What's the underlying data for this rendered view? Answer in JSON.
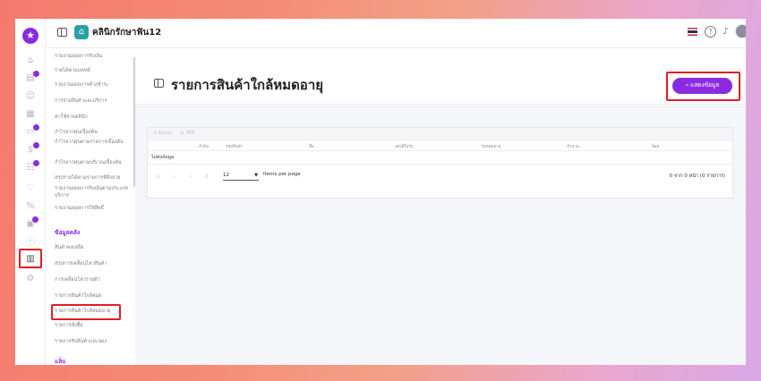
{
  "header": {
    "clinic_name": "คลินิกรักษาฟัน12"
  },
  "rail_icons": [
    "home-icon",
    "document-icon",
    "user-icon",
    "calendar-icon",
    "receipt-icon",
    "dollar-icon",
    "people-icon",
    "chart-icon",
    "tooth-icon",
    "percent-icon",
    "clipboard-icon",
    "info-icon",
    "report-icon",
    "settings-icon"
  ],
  "menu": {
    "items": [
      "รายงานยอดการรับเงิน",
      "รายได้ตามแพทย์",
      "รายงานยอดการค้างชำระ",
      "การจ่ายสินค้าและบริการ",
      "ค่าใช้จ่ายคลินิก",
      "กำไรจากทุนเบื้องต้น",
      "กำไรจากทุนตามรายการเบื้องต้น",
      "กำไรจากทุนตามบริเวณเบื้องต้น",
      "สรุปรายได้ตามรายการที่สั่งจ่าย",
      "รายงานยอดการรับเงินตามประเภทบริการ",
      "รายงานยอดการใช้สิทธิ์"
    ],
    "section_stock": "ข้อมูลคลัง",
    "stock_items": [
      "สินค้าคงเหลือ",
      "สรุปการเคลื่อนไหวสินค้า",
      "การเคลื่อนไหวรายตัว",
      "รายการสินค้าใกล้หมด",
      "รายการสินค้าใกล้หมดอายุ",
      "รายการสั่งซื้อ",
      "รายการรับสินค้าและจอง"
    ],
    "section_other": "แล็บ"
  },
  "page": {
    "title": "รายการสินค้าใกล้หมดอายุ",
    "show_button": "แสดงข้อมูล"
  },
  "table": {
    "exports": [
      "Excel",
      "PDF"
    ],
    "columns": [
      "ลำดับ",
      "รหัสสินค้า",
      "ชื่อ",
      "เลขที่ใบรับ",
      "วันหมดอายุ",
      "จำนวน",
      "ล็อต"
    ],
    "empty_text": "ไม่พบข้อมูล",
    "per_page_value": "12",
    "per_page_label": "Items per page",
    "range_text": "0 จาก 0 หน้า (0 รายการ)"
  },
  "colors": {
    "accent": "#8a2be2",
    "highlight": "#e01e25"
  }
}
